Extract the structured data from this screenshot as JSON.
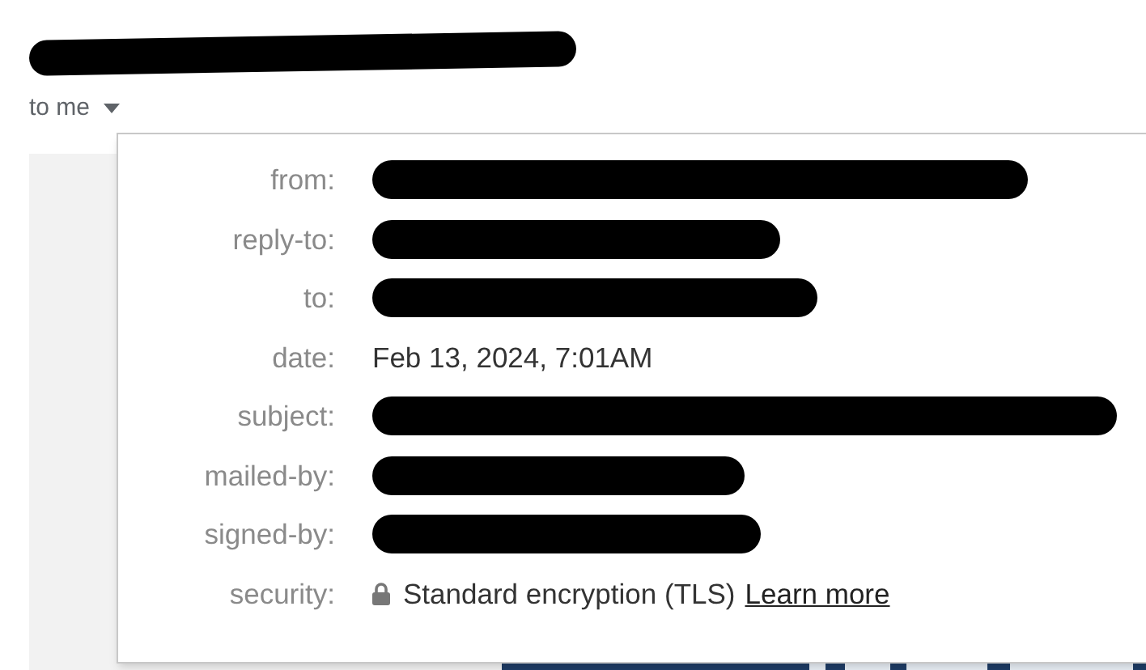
{
  "header": {
    "sender": {
      "redacted": true
    },
    "recipient": "to me"
  },
  "details": [
    {
      "label": "from:",
      "kind": "redacted"
    },
    {
      "label": "reply-to:",
      "kind": "redacted"
    },
    {
      "label": "to:",
      "kind": "redacted"
    },
    {
      "label": "date:",
      "kind": "text",
      "value": "Feb 13, 2024, 7:01AM"
    },
    {
      "label": "subject:",
      "kind": "redacted"
    },
    {
      "label": "mailed-by:",
      "kind": "redacted"
    },
    {
      "label": "signed-by:",
      "kind": "redacted"
    },
    {
      "label": "security:",
      "kind": "security",
      "value": "Standard encryption (TLS)",
      "link": "Learn more"
    }
  ]
}
